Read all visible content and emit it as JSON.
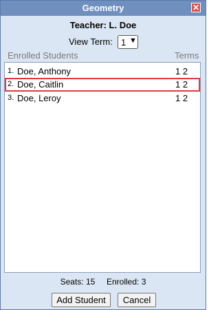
{
  "window": {
    "title": "Geometry"
  },
  "header": {
    "teacher": "Teacher: L. Doe",
    "view_term_label": "View Term:",
    "view_term_value": "1"
  },
  "list": {
    "col_students": "Enrolled Students",
    "col_terms": "Terms",
    "rows": [
      {
        "num": "1.",
        "name": "Doe, Anthony",
        "terms": "1 2"
      },
      {
        "num": "2.",
        "name": "Doe, Caitlin",
        "terms": "1 2"
      },
      {
        "num": "3.",
        "name": "Doe, Leroy",
        "terms": "1 2"
      }
    ]
  },
  "footer": {
    "seats": "Seats: 15",
    "enrolled": "Enrolled: 3"
  },
  "buttons": {
    "add": "Add Student",
    "cancel": "Cancel"
  },
  "colors": {
    "titlebar": "#6f8fbf",
    "highlight": "#e03b3b",
    "panel": "#dbe6f4"
  },
  "icons": {
    "close": "close-icon",
    "dropdown": "chevron-down-icon"
  }
}
